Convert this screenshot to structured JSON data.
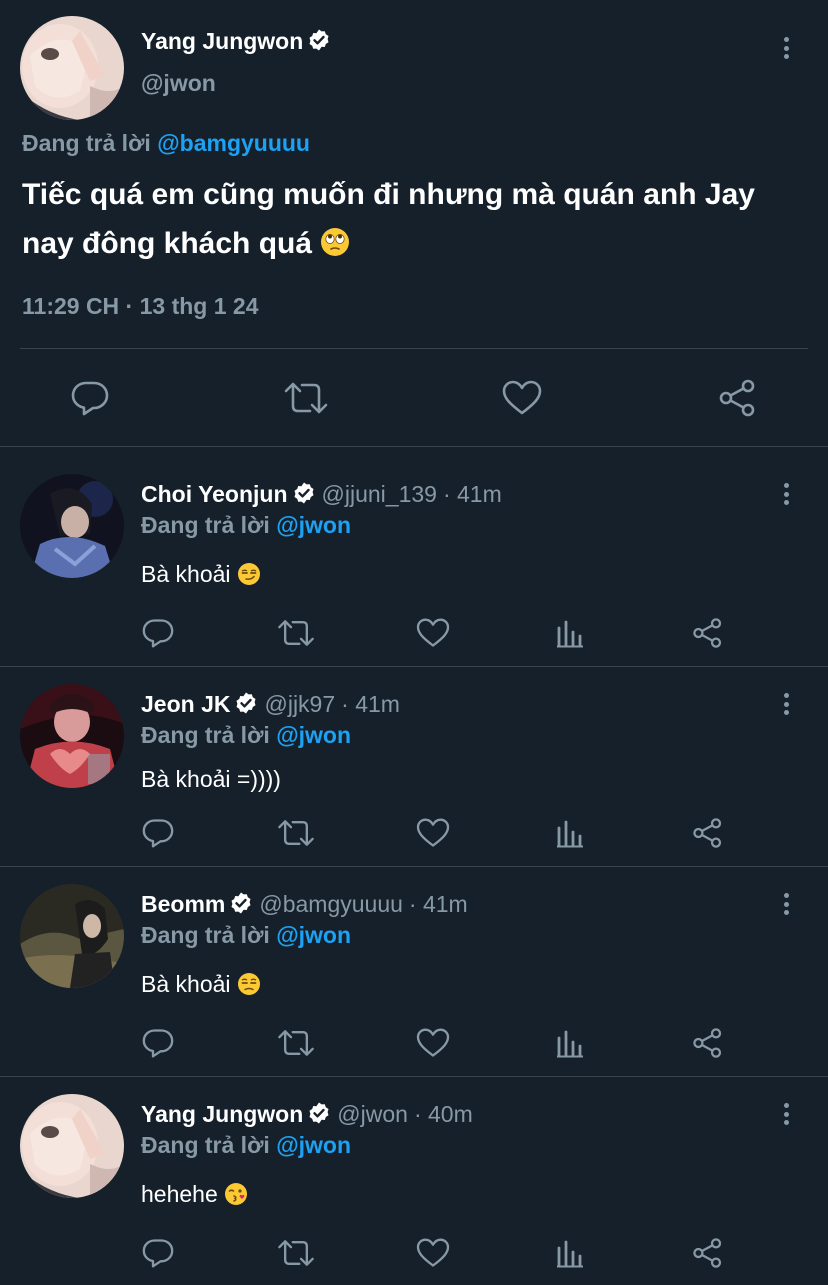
{
  "main_tweet": {
    "author_name": "Yang Jungwon",
    "handle": "@jwon",
    "replying_prefix": "Đang trả lời",
    "replying_to": "@bamgyuuuu",
    "text": "Tiếc quá em cũng muốn đi nhưng mà quán anh Jay nay đông khách quá",
    "emoji": "face-with-rolling-eyes",
    "timestamp": "11:29 CH · 13 thg 1 24",
    "actions": [
      "reply-icon",
      "retweet-icon",
      "like-icon",
      "share-icon"
    ]
  },
  "replies": [
    {
      "author_name": "Choi Yeonjun",
      "handle": "@jjuni_139",
      "time": "· 41m",
      "replying_prefix": "Đang trả lời",
      "replying_to": "@jwon",
      "text": "Bà khoải",
      "emoji": "smirking-face"
    },
    {
      "author_name": "Jeon JK",
      "handle": "@jjk97",
      "time": "· 41m",
      "replying_prefix": "Đang trả lời",
      "replying_to": "@jwon",
      "text": "Bà khoải =))))",
      "emoji": ""
    },
    {
      "author_name": "Beomm",
      "handle": "@bamgyuuuu",
      "time": "· 41m",
      "replying_prefix": "Đang trả lời",
      "replying_to": "@jwon",
      "text": "Bà khoải",
      "emoji": "unamused-face"
    },
    {
      "author_name": "Yang Jungwon",
      "handle": "@jwon",
      "time": "· 40m",
      "replying_prefix": "Đang trả lời",
      "replying_to": "@jwon",
      "text": "hehehe",
      "emoji": "face-blowing-kiss"
    }
  ],
  "colors": {
    "background": "#15202b",
    "text_primary": "#ffffff",
    "text_secondary": "#8899a6",
    "accent": "#1da1f2",
    "divider": "#38444d"
  }
}
